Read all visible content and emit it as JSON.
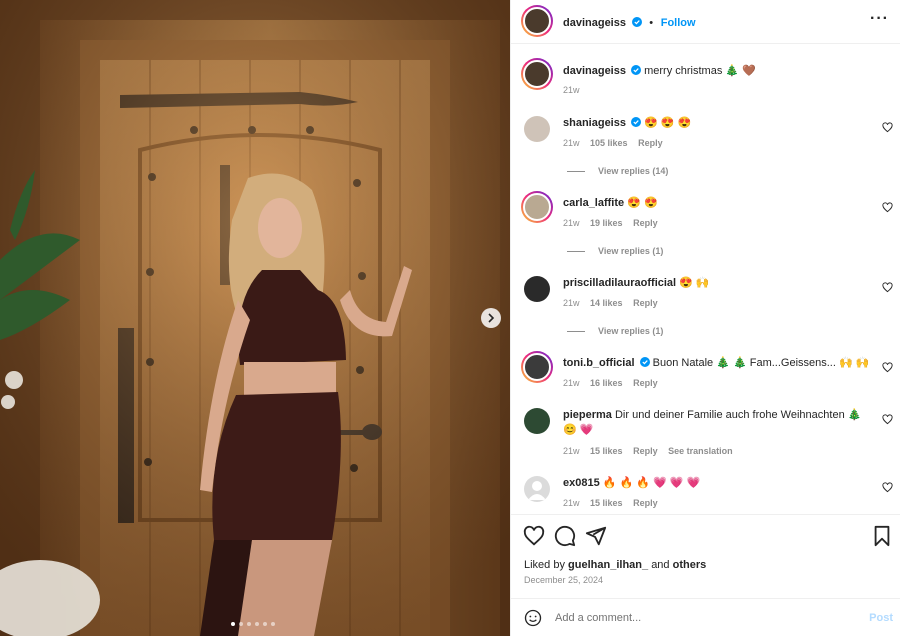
{
  "post": {
    "author": "davinageiss",
    "follow_label": "Follow",
    "caption": "merry christmas 🎄 🤎",
    "caption_age": "21w",
    "liked_by_prefix": "Liked by",
    "liked_by_user": "guelhan_ilhan_",
    "liked_by_joiner": "and",
    "liked_by_others": "others",
    "date": "December 25, 2024",
    "carousel": {
      "slides": 6,
      "active_index": 0
    }
  },
  "comments": [
    {
      "user": "shaniageiss",
      "verified": true,
      "text": "😍 😍 😍",
      "age": "21w",
      "likes": "105 likes",
      "reply": "Reply",
      "view_replies": "View replies (14)"
    },
    {
      "user": "carla_laffite",
      "verified": false,
      "text": "😍 😍",
      "age": "21w",
      "likes": "19 likes",
      "reply": "Reply",
      "view_replies": "View replies (1)"
    },
    {
      "user": "priscilladilauraofficial",
      "verified": false,
      "text": "😍 🙌",
      "age": "21w",
      "likes": "14 likes",
      "reply": "Reply",
      "view_replies": "View replies (1)"
    },
    {
      "user": "toni.b_official",
      "verified": true,
      "text": "Buon Natale 🎄 🎄 Fam...Geissens... 🙌 🙌",
      "age": "21w",
      "likes": "16 likes",
      "reply": "Reply"
    },
    {
      "user": "pieperma",
      "verified": false,
      "text": "Dir und deiner Familie auch frohe Weihnachten 🎄 😊 💗",
      "age": "21w",
      "likes": "15 likes",
      "reply": "Reply",
      "see_translation": "See translation"
    },
    {
      "user": "ex0815",
      "verified": false,
      "text": "🔥 🔥 🔥 💗 💗 💗",
      "age": "21w",
      "likes": "15 likes",
      "reply": "Reply"
    }
  ],
  "add_comment": {
    "placeholder": "Add a comment...",
    "post_label": "Post"
  },
  "colors": {
    "link_blue": "#0095f6",
    "verified_blue": "#0095f6",
    "muted": "#8e8e8e",
    "post_disabled": "#b3dbff"
  },
  "icons": [
    "more-icon",
    "heart-icon",
    "comment-icon",
    "share-icon",
    "bookmark-icon",
    "emoji-icon",
    "chevron-right-icon",
    "verified-badge-icon"
  ]
}
